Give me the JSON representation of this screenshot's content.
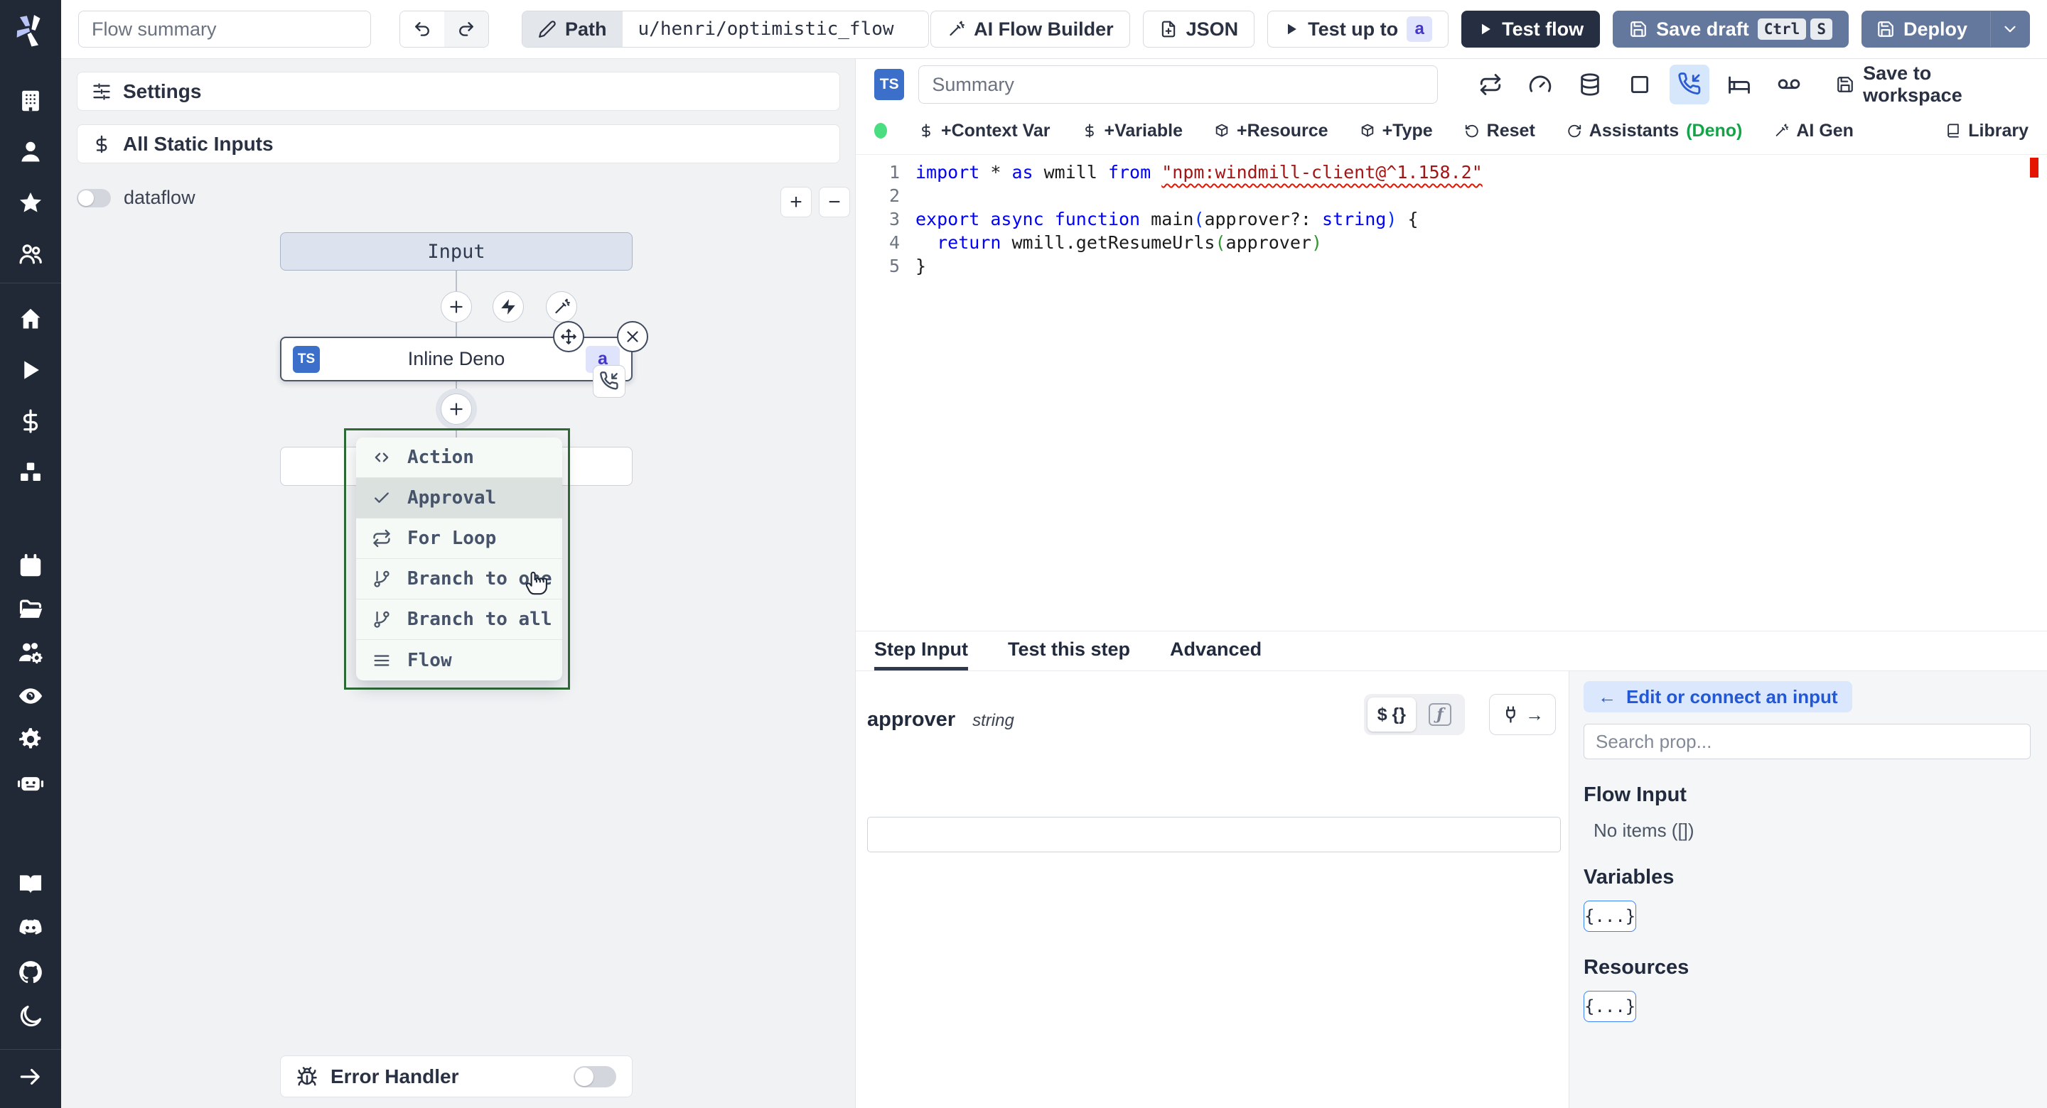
{
  "topbar": {
    "flow_summary_placeholder": "Flow summary",
    "path_button": "Path",
    "path_value": "u/henri/optimistic_flow",
    "ai_flow_builder": "AI Flow Builder",
    "json_button": "JSON",
    "test_up_to": "Test up to",
    "test_up_to_badge": "a",
    "test_flow": "Test flow",
    "save_draft": "Save draft",
    "save_draft_keys": [
      "Ctrl",
      "S"
    ],
    "deploy": "Deploy"
  },
  "sidebar_rail": {
    "logo": "windmill-logo",
    "top_icons": [
      "building",
      "user",
      "star",
      "users"
    ],
    "mid_icons": [
      "home",
      "play",
      "dollar",
      "boxes"
    ],
    "workspace_icons": [
      "calendar",
      "folder",
      "users-cog",
      "eye",
      "settings-gear",
      "robot"
    ],
    "bottom_icons": [
      "book-open",
      "discord",
      "github",
      "moon"
    ],
    "expand_icon": "arrow-right"
  },
  "flow_panel": {
    "settings": "Settings",
    "all_static_inputs": "All Static Inputs",
    "dataflow_label": "dataflow",
    "zoom_in": "+",
    "zoom_out": "−",
    "input_node": "Input",
    "step_node": {
      "lang_badge": "TS",
      "label": "Inline Deno",
      "id_badge": "a"
    },
    "insert_menu": {
      "border_color": "#2d6a35",
      "items": [
        {
          "label": "Action",
          "icon": "code",
          "selected": false
        },
        {
          "label": "Approval",
          "icon": "check",
          "selected": true
        },
        {
          "label": "For Loop",
          "icon": "repeat",
          "selected": false
        },
        {
          "label": "Branch to one",
          "icon": "git-branch",
          "selected": false
        },
        {
          "label": "Branch to all",
          "icon": "git-branch",
          "selected": false
        },
        {
          "label": "Flow",
          "icon": "list",
          "selected": false
        }
      ]
    },
    "error_handler": "Error Handler"
  },
  "editor": {
    "lang_badge": "TS",
    "summary_placeholder": "Summary",
    "header_icons": [
      {
        "name": "repeat",
        "active": false
      },
      {
        "name": "gauge",
        "active": false
      },
      {
        "name": "database",
        "active": false
      },
      {
        "name": "square",
        "active": false
      },
      {
        "name": "phone-in",
        "active": true
      },
      {
        "name": "bed",
        "active": false
      },
      {
        "name": "voicemail",
        "active": false
      }
    ],
    "save_to_workspace": "Save to workspace",
    "status_dot_color": "#4ade80",
    "actions": [
      {
        "icon": "dollar",
        "label": "+Context Var"
      },
      {
        "icon": "dollar",
        "label": "+Variable"
      },
      {
        "icon": "box",
        "label": "+Resource"
      },
      {
        "icon": "box",
        "label": "+Type"
      },
      {
        "icon": "rotate-ccw",
        "label": "Reset"
      },
      {
        "icon": "refresh",
        "label": "Assistants",
        "suffix": "(Deno)",
        "suffix_color": "#15a34a"
      },
      {
        "icon": "wand",
        "label": "AI Gen"
      }
    ],
    "library": "Library",
    "code": {
      "lines": [
        [
          [
            "kw",
            "import"
          ],
          [
            "pl",
            " * "
          ],
          [
            "kw",
            "as"
          ],
          [
            "pl",
            " wmill "
          ],
          [
            "kw",
            "from"
          ],
          [
            "pl",
            " "
          ],
          [
            "str-err",
            "\"npm:windmill-client@^1.158.2\""
          ]
        ],
        [],
        [
          [
            "kw",
            "export"
          ],
          [
            "pl",
            " "
          ],
          [
            "kw",
            "async"
          ],
          [
            "pl",
            " "
          ],
          [
            "kw",
            "function"
          ],
          [
            "pl",
            " main"
          ],
          [
            "pb",
            "("
          ],
          [
            "pl",
            "approver?: "
          ],
          [
            "kw",
            "string"
          ],
          [
            "pb",
            ")"
          ],
          [
            "pl",
            " {"
          ]
        ],
        [
          [
            "pl",
            "  "
          ],
          [
            "kw",
            "return"
          ],
          [
            "pl",
            " wmill.getResumeUrls"
          ],
          [
            "pg",
            "("
          ],
          [
            "pl",
            "approver"
          ],
          [
            "pg",
            ")"
          ]
        ],
        [
          [
            "pl",
            "}"
          ]
        ]
      ]
    }
  },
  "step_panel": {
    "tabs": [
      {
        "label": "Step Input",
        "active": true
      },
      {
        "label": "Test this step",
        "active": false
      },
      {
        "label": "Advanced",
        "active": false
      }
    ],
    "field_name": "approver",
    "field_type": "string",
    "expr_toggle": "$ {}",
    "fn_toggle": "ƒ",
    "field_value": ""
  },
  "right_sidebar": {
    "edit_or_connect": "Edit or connect an input",
    "back_arrow": "←",
    "search_placeholder": "Search prop...",
    "sections": [
      {
        "title": "Flow Input",
        "empty_text": "No items ([])"
      },
      {
        "title": "Variables",
        "chip": "{...}"
      },
      {
        "title": "Resources",
        "chip": "{...}"
      }
    ]
  },
  "colors": {
    "rail_bg": "#222936",
    "primary_dark": "#262f42",
    "slate_button": "#64779d",
    "badge_bg": "#dfe3fb",
    "badge_text": "#4538c9",
    "menu_border_green": "#2d6a35",
    "deno_green": "#15a34a",
    "active_tool_bg": "#d6e6fb",
    "ts_blue": "#3b6fc9",
    "keyword_blue": "#0000ff",
    "string_red": "#a31515"
  }
}
